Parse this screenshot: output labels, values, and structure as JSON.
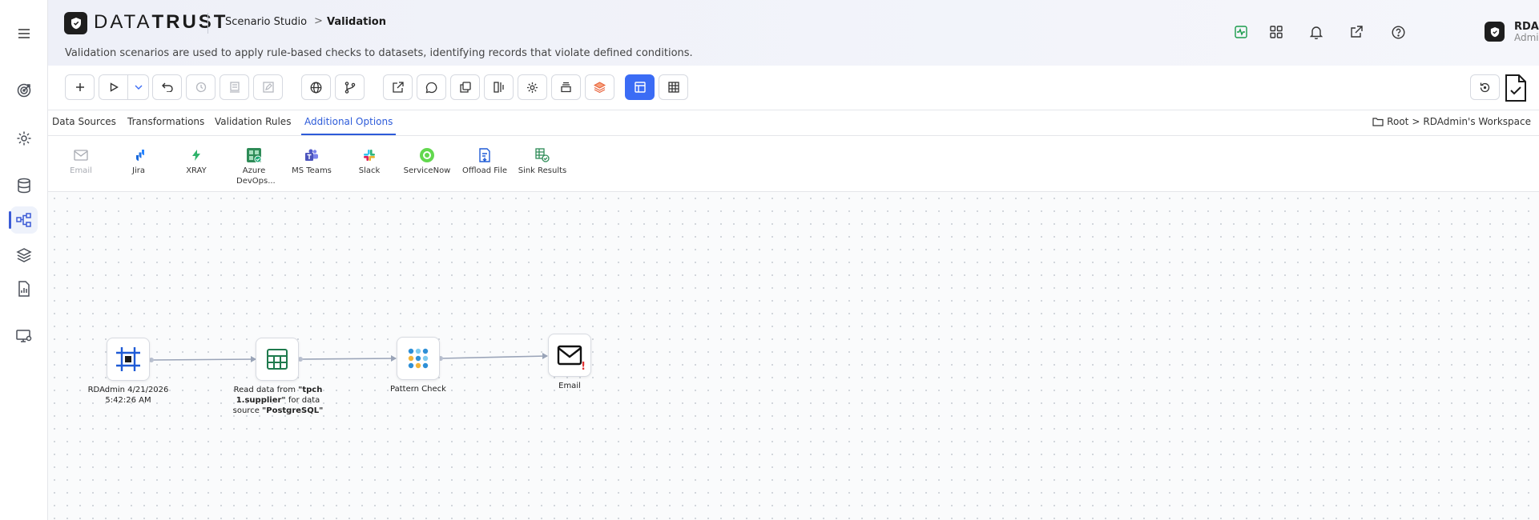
{
  "app": {
    "brand_light": "DATA",
    "brand_bold": "TRUST",
    "breadcrumb_parent": "Scenario Studio",
    "breadcrumb_sep": ">",
    "breadcrumb_current": "Validation",
    "description": "Validation scenarios are used to apply rule-based checks to datasets, identifying records that violate defined conditions."
  },
  "user": {
    "name": "RDAdmin",
    "role": "Admin"
  },
  "rail_icons": [
    "menu-icon",
    "target-icon",
    "gear-icon",
    "database-icon",
    "workflow-icon",
    "layers-icon",
    "report-icon",
    "monitor-settings-icon"
  ],
  "header_icons": [
    "activity-icon",
    "apps-grid-icon",
    "bell-icon",
    "external-link-icon",
    "help-icon"
  ],
  "toolbar_icons": [
    "add-icon",
    "run-icon",
    "run-options-chevron-icon",
    "undo-icon",
    "history-icon",
    "template-icon",
    "edit-icon",
    "globe-icon",
    "branch-icon",
    "export-icon",
    "comment-icon",
    "copy-icon",
    "compare-icon",
    "settings-icon",
    "archive-icon",
    "layers-stack-icon",
    "layout-icon",
    "table-icon",
    "restore-icon",
    "document-check-icon"
  ],
  "tabs": [
    {
      "label": "Data Sources"
    },
    {
      "label": "Transformations"
    },
    {
      "label": "Validation Rules"
    },
    {
      "label": "Additional Options",
      "active": true
    }
  ],
  "workspace": {
    "root": "Root",
    "sep": ">",
    "name": "RDAdmin's Workspace"
  },
  "options": [
    {
      "label": "Email",
      "icon": "mail-icon",
      "enabled": false
    },
    {
      "label": "Jira",
      "icon": "jira-icon",
      "enabled": true
    },
    {
      "label": "XRAY",
      "icon": "xray-icon",
      "enabled": true
    },
    {
      "label": "Azure DevOps...",
      "icon": "azure-devops-icon",
      "enabled": true
    },
    {
      "label": "MS Teams",
      "icon": "teams-icon",
      "enabled": true
    },
    {
      "label": "Slack",
      "icon": "slack-icon",
      "enabled": true
    },
    {
      "label": "ServiceNow",
      "icon": "servicenow-icon",
      "enabled": true
    },
    {
      "label": "Offload File",
      "icon": "offload-file-icon",
      "enabled": true
    },
    {
      "label": "Sink Results",
      "icon": "sink-results-icon",
      "enabled": true
    }
  ],
  "nodes": [
    {
      "id": "start",
      "icon": "trigger-icon",
      "label": "RDAdmin 4/21/2026 5:42:26 AM"
    },
    {
      "id": "read",
      "icon": "table-icon",
      "label_prefix": "Read data from ",
      "table": "\"tpch1.supplier\"",
      "label_mid": " for data source ",
      "source": "\"PostgreSQL\""
    },
    {
      "id": "pattern",
      "icon": "pattern-icon",
      "label": "Pattern Check"
    },
    {
      "id": "email",
      "icon": "mail-icon",
      "label": "Email",
      "warning": "!"
    }
  ],
  "colors": {
    "accent": "#3b6cf5",
    "active_tab": "#2d5bd9",
    "warning": "#e03131"
  }
}
